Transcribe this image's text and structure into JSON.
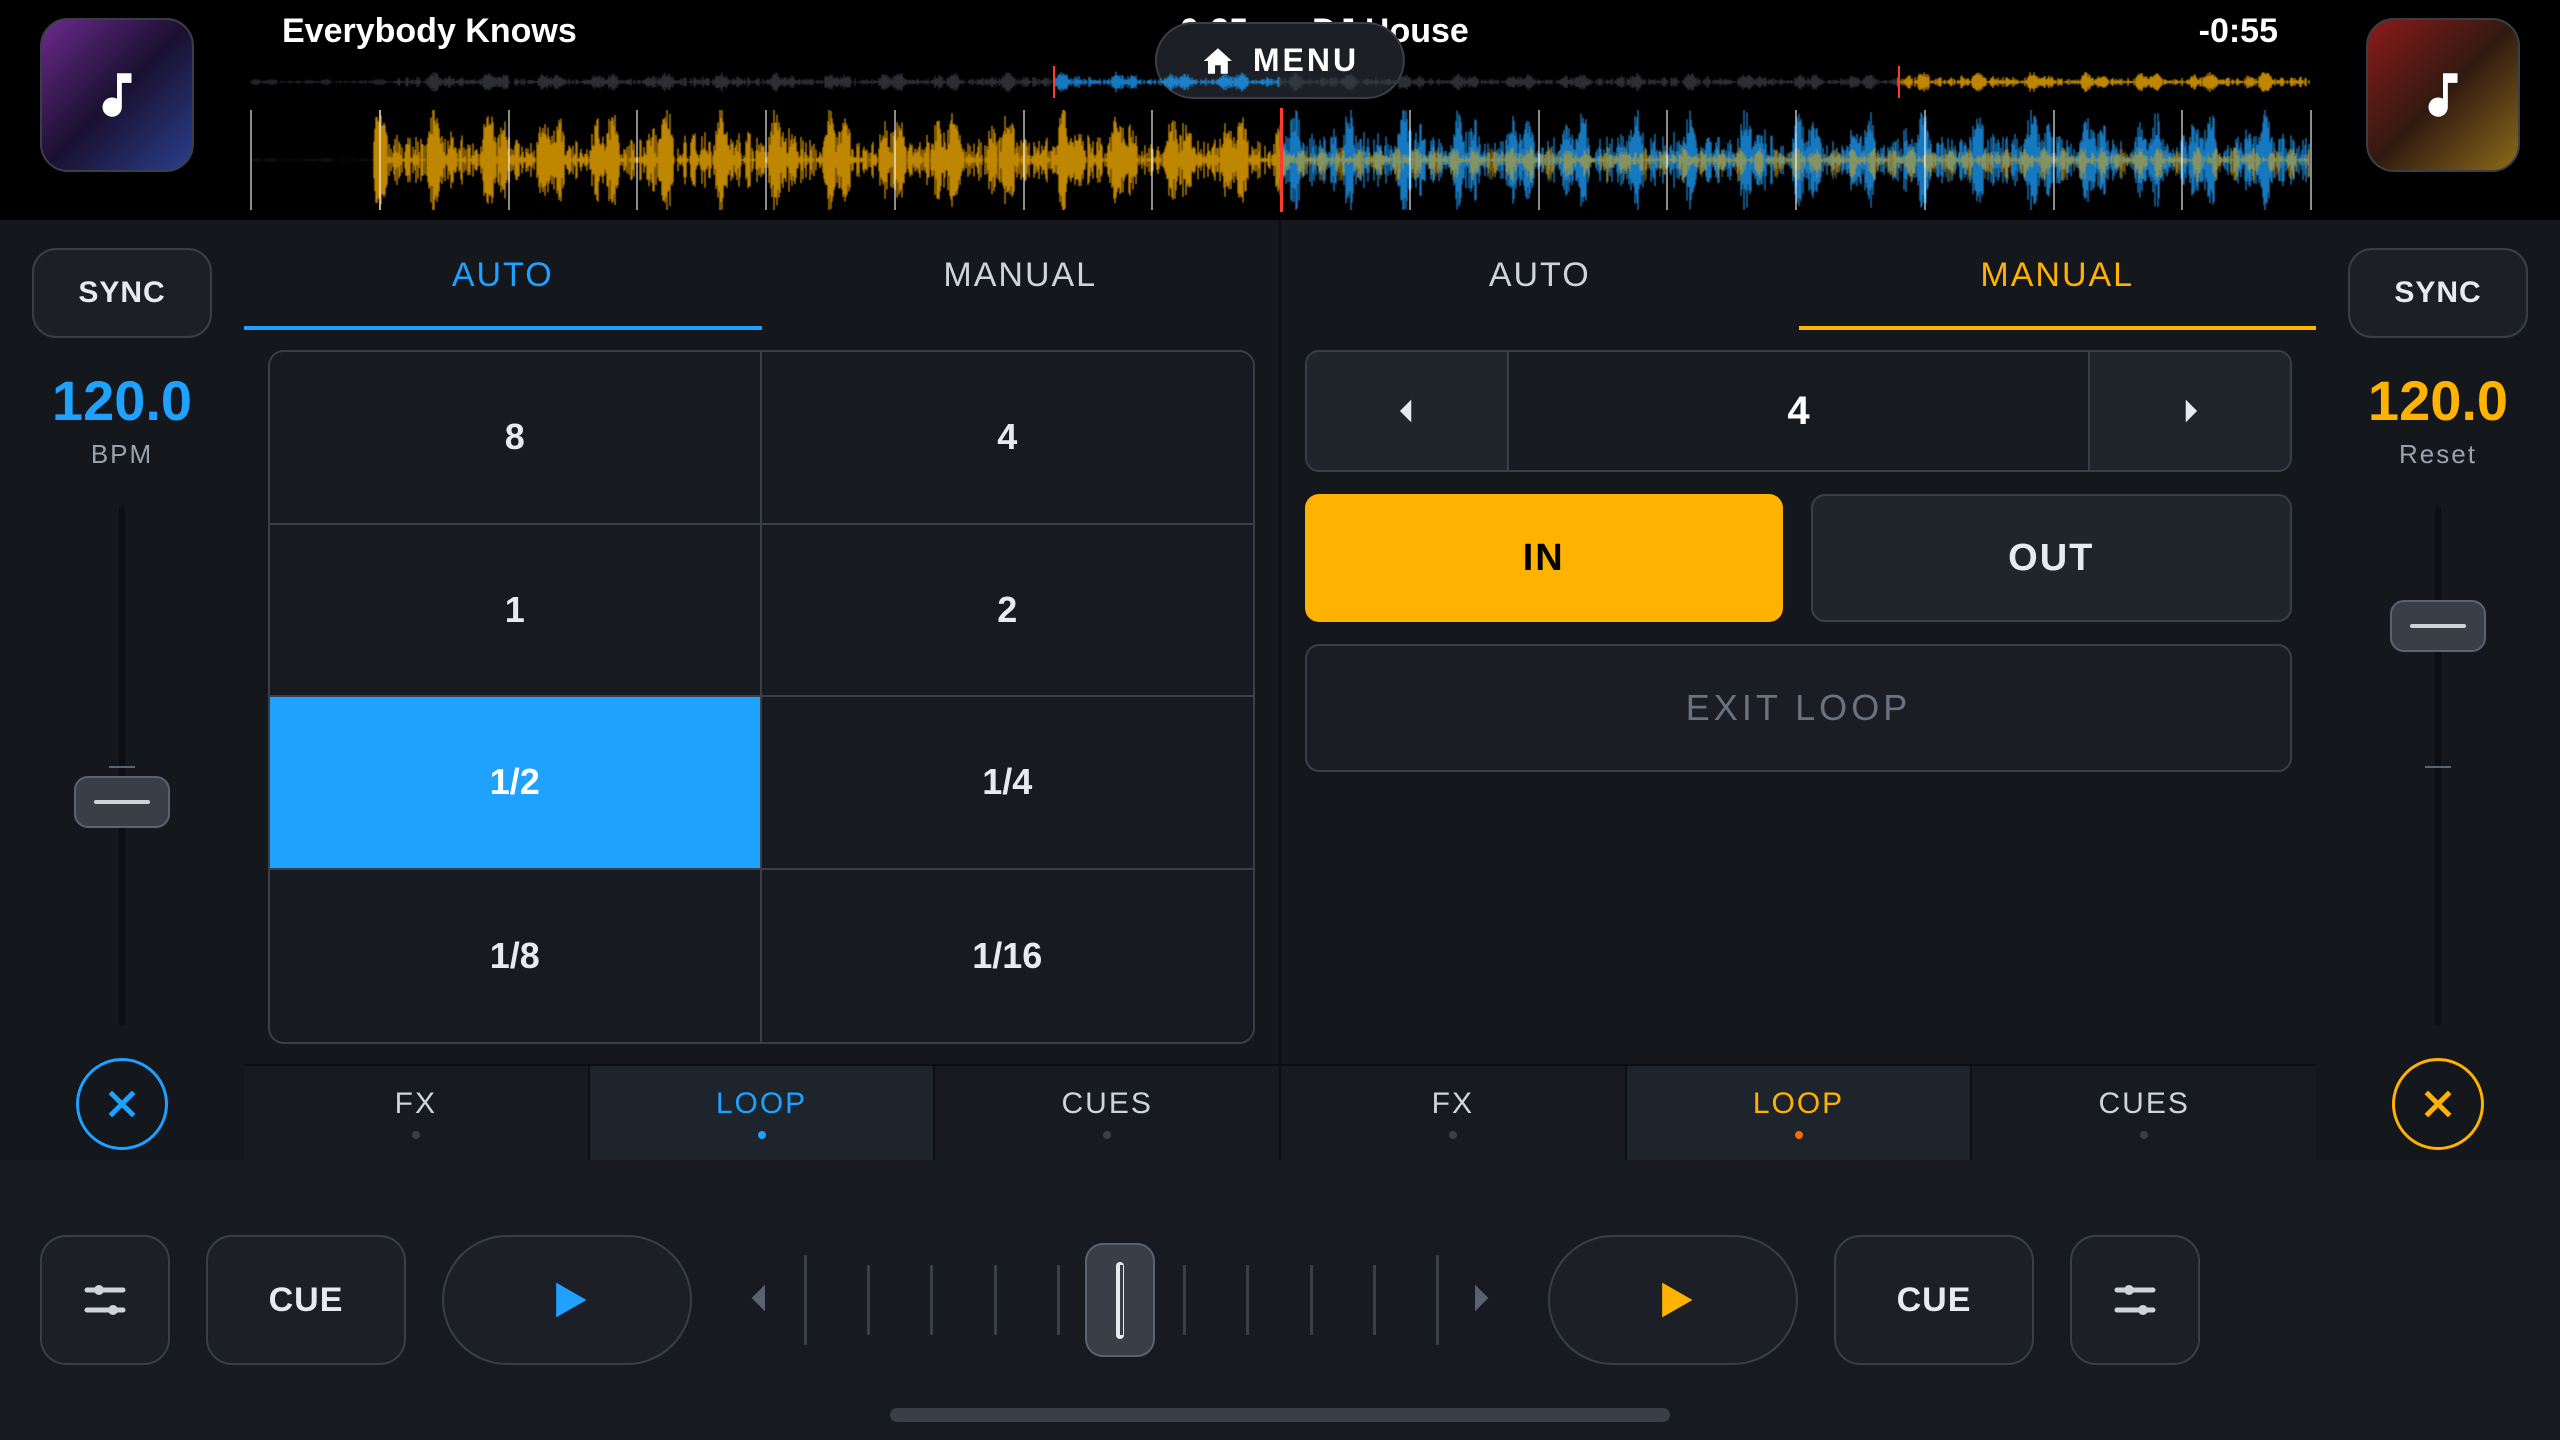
{
  "colors": {
    "blue": "#1ea1ff",
    "amber": "#ffb300"
  },
  "menu_label": "MENU",
  "deck_left": {
    "track_title": "Everybody Knows",
    "time_remaining": "-0:25",
    "sync_label": "SYNC",
    "bpm_value": "120.0",
    "bpm_sublabel": "BPM",
    "tempo_thumb_pos_pct": 52,
    "tabs": {
      "auto": "AUTO",
      "manual": "MANUAL",
      "active": "auto"
    },
    "loop_grid": [
      "8",
      "4",
      "1",
      "2",
      "1/2",
      "1/4",
      "1/8",
      "1/16"
    ],
    "loop_grid_active_index": 4,
    "subtabs": [
      "FX",
      "LOOP",
      "CUES"
    ],
    "subtab_active_index": 1
  },
  "deck_right": {
    "track_title": "DJ House",
    "time_remaining": "-0:55",
    "sync_label": "SYNC",
    "bpm_value": "120.0",
    "bpm_sublabel": "Reset",
    "tempo_thumb_pos_pct": 18,
    "tabs": {
      "auto": "AUTO",
      "manual": "MANUAL",
      "active": "manual"
    },
    "stepper_value": "4",
    "in_label": "IN",
    "out_label": "OUT",
    "exit_label": "EXIT LOOP",
    "subtabs": [
      "FX",
      "LOOP",
      "CUES"
    ],
    "subtab_active_index": 1
  },
  "transport": {
    "cue_label": "CUE",
    "crossfader_pos_pct": 50
  }
}
